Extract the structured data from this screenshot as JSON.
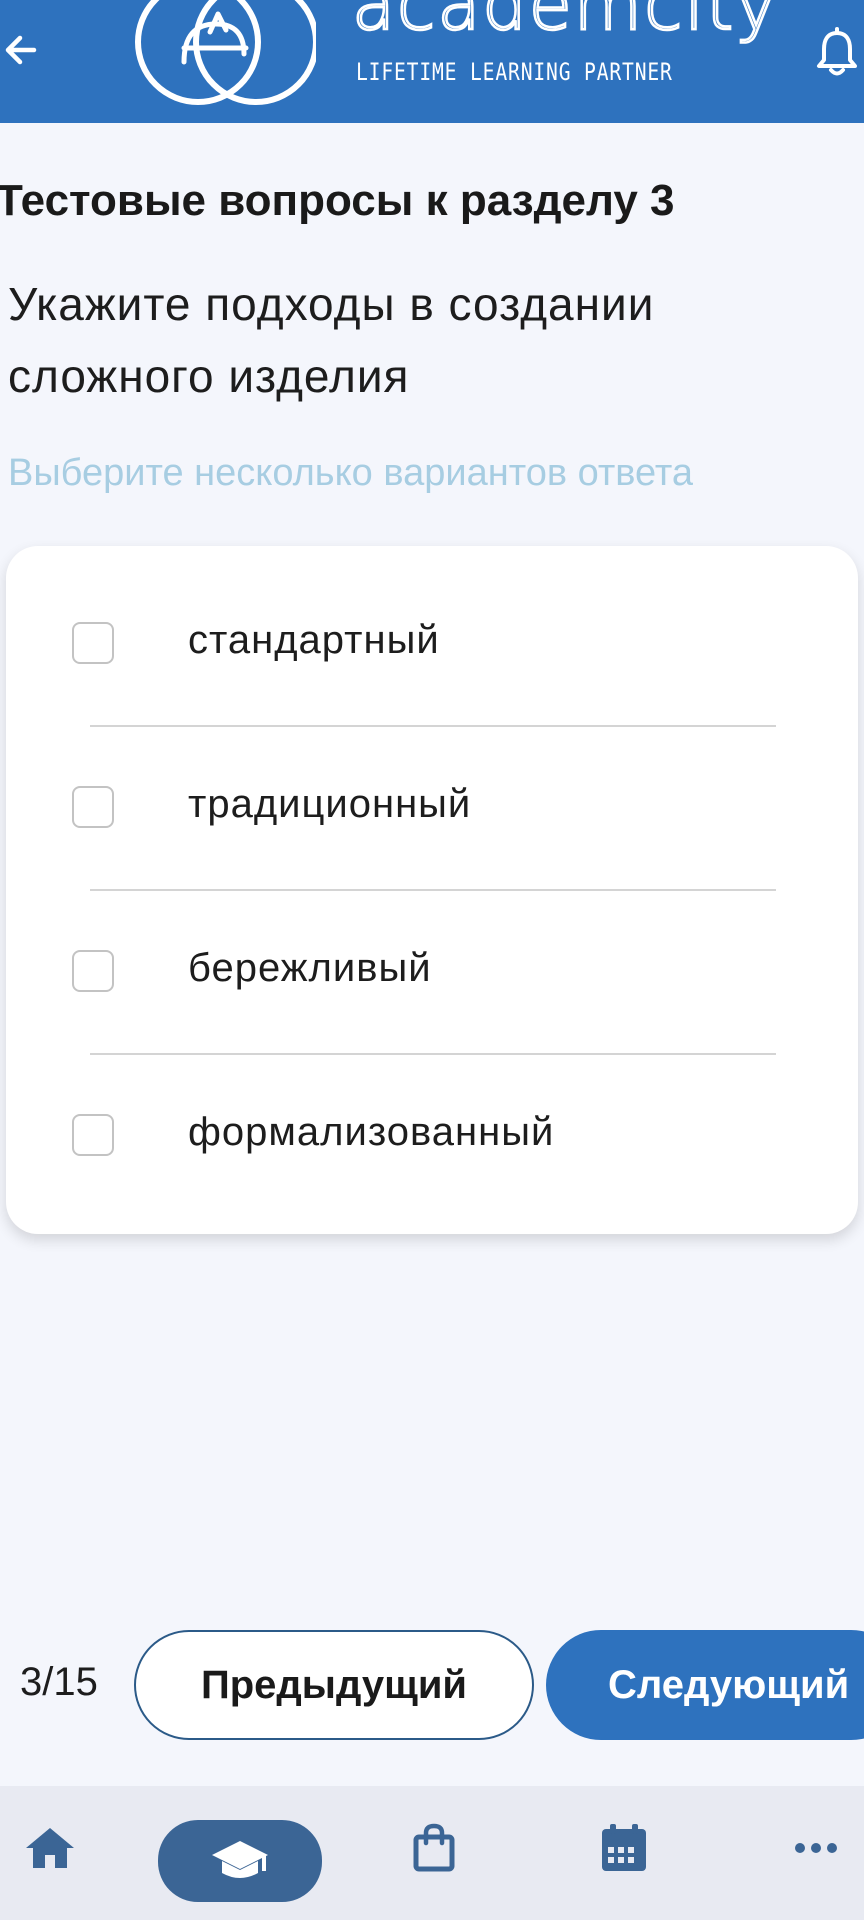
{
  "header": {
    "back_icon": "arrow-left-icon",
    "logo_word": "academcity",
    "logo_tagline": "LIFETIME LEARNING PARTNER",
    "bell_icon": "bell-icon",
    "bg_color": "#2e72be"
  },
  "test": {
    "section_title": "Тестовые вопросы к разделу 3",
    "question": "Укажите подходы в создании сложного изделия",
    "hint": "Выберите несколько вариантов ответа",
    "options": [
      {
        "label": "стандартный",
        "checked": false
      },
      {
        "label": "традиционный",
        "checked": false
      },
      {
        "label": "бережливый",
        "checked": false
      },
      {
        "label": "формализованный",
        "checked": false
      }
    ]
  },
  "pager": {
    "counter": "3/15",
    "prev_label": "Предыдущий",
    "next_label": "Следующий"
  },
  "bottom_nav": {
    "items": [
      {
        "icon": "home-icon",
        "active": false
      },
      {
        "icon": "graduation-cap-icon",
        "active": true
      },
      {
        "icon": "shopping-bag-icon",
        "active": false
      },
      {
        "icon": "calendar-icon",
        "active": false
      },
      {
        "icon": "more-icon",
        "active": false
      }
    ]
  },
  "colors": {
    "accent": "#2e72be",
    "nav_icon": "#3b6595",
    "hint": "#a7cde2",
    "background": "#f4f6fc"
  }
}
